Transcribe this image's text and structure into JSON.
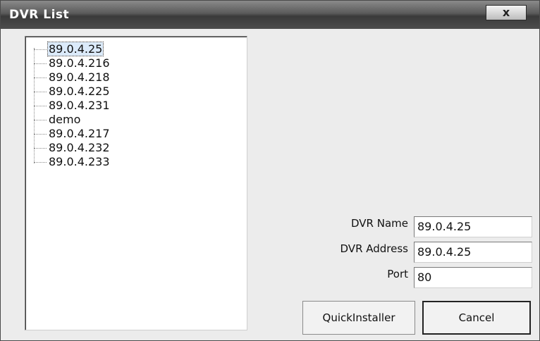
{
  "window": {
    "title": "DVR List",
    "close_glyph": "x"
  },
  "tree": {
    "items": [
      {
        "label": "89.0.4.25",
        "selected": true
      },
      {
        "label": "89.0.4.216"
      },
      {
        "label": "89.0.4.218"
      },
      {
        "label": "89.0.4.225"
      },
      {
        "label": "89.0.4.231"
      },
      {
        "label": "demo"
      },
      {
        "label": "89.0.4.217"
      },
      {
        "label": "89.0.4.232"
      },
      {
        "label": "89.0.4.233"
      }
    ]
  },
  "form": {
    "name_label": "DVR Name",
    "name_value": "89.0.4.25",
    "address_label": "DVR Address",
    "address_value": "89.0.4.25",
    "port_label": "Port",
    "port_value": "80"
  },
  "buttons": {
    "quickinstaller": "QuickInstaller",
    "cancel": "Cancel"
  }
}
